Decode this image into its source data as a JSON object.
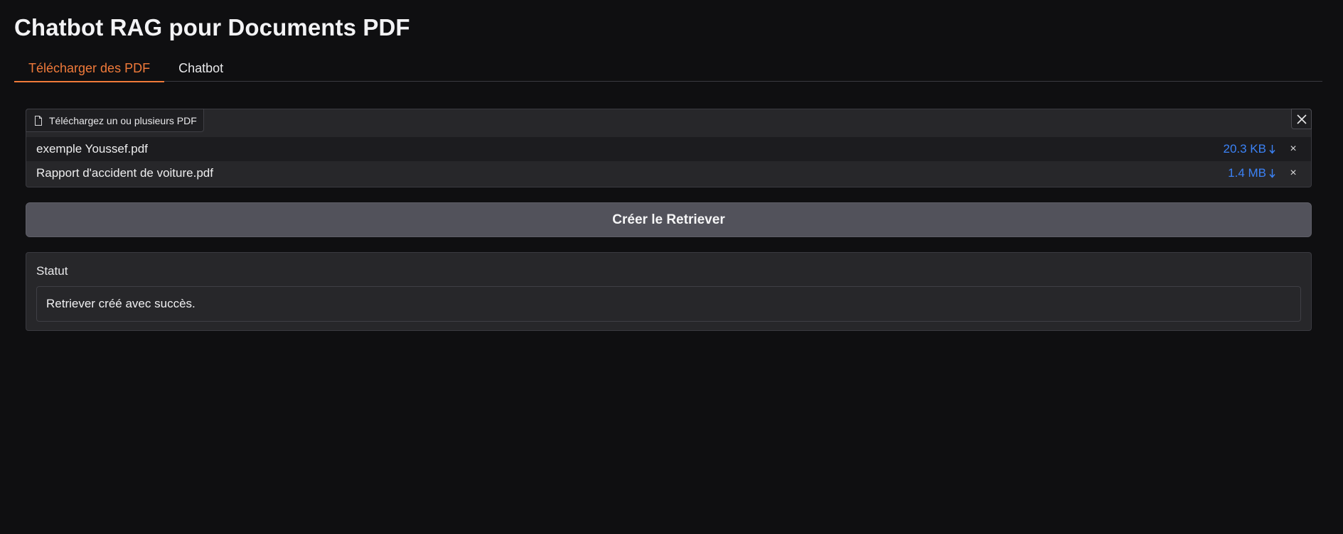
{
  "page": {
    "title": "Chatbot RAG pour Documents PDF"
  },
  "tabs": [
    {
      "label": "Télécharger des PDF",
      "active": true
    },
    {
      "label": "Chatbot",
      "active": false
    }
  ],
  "upload": {
    "label": "Téléchargez un ou plusieurs PDF",
    "files": [
      {
        "name": "exemple Youssef.pdf",
        "size": "20.3 KB"
      },
      {
        "name": "Rapport d'accident de voiture.pdf",
        "size": "1.4 MB"
      }
    ],
    "icons": {
      "file": "file-icon",
      "clear": "close-icon",
      "download": "download-arrow-icon",
      "remove": "remove-x-icon"
    }
  },
  "actions": {
    "create_retriever": "Créer le Retriever"
  },
  "status": {
    "label": "Statut",
    "value": "Retriever créé avec succès."
  },
  "colors": {
    "background": "#0f0f11",
    "panel": "#27272a",
    "accent_orange": "#f07a3a",
    "link_blue": "#3b82f6",
    "button": "#52525b"
  }
}
